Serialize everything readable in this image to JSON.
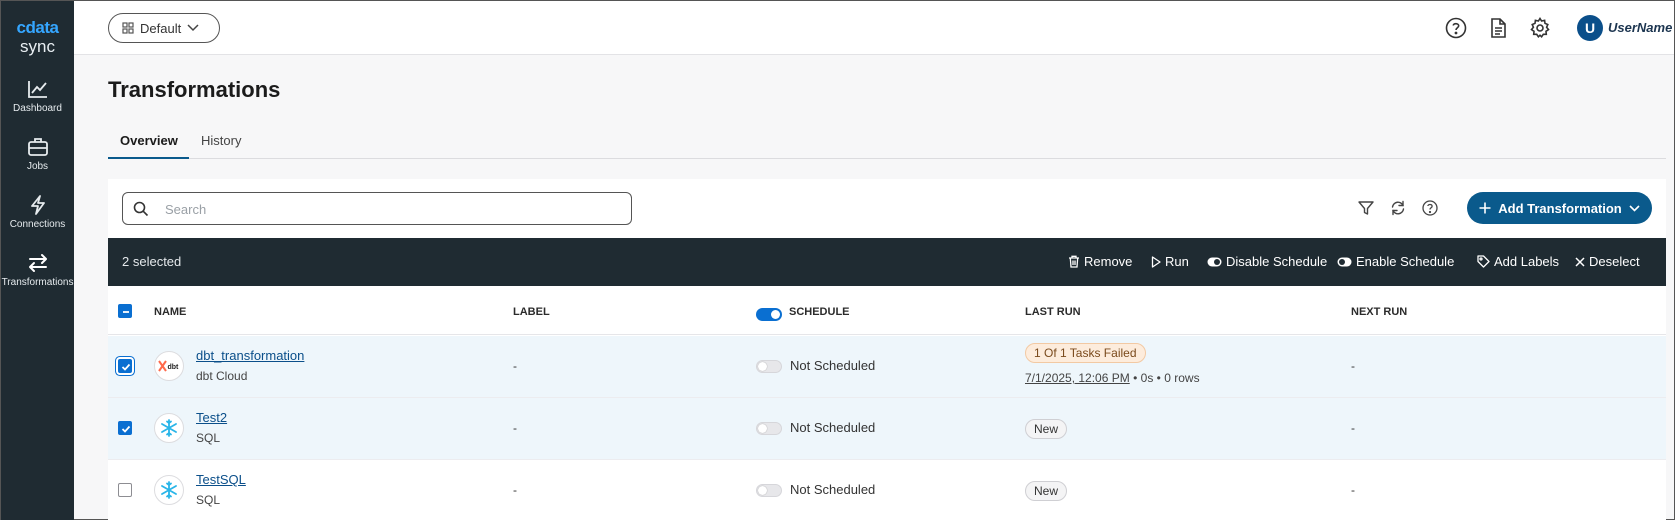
{
  "sidebar": {
    "logo_top": "cdata",
    "logo_bottom": "sync",
    "items": [
      {
        "label": "Dashboard",
        "icon": "chart-line-icon"
      },
      {
        "label": "Jobs",
        "icon": "briefcase-icon"
      },
      {
        "label": "Connections",
        "icon": "lightning-icon"
      },
      {
        "label": "Transformations",
        "icon": "arrows-exchange-icon"
      }
    ]
  },
  "topbar": {
    "workspace_label": "Default",
    "user_initial": "U",
    "username": "UserName"
  },
  "page": {
    "title": "Transformations",
    "tabs": [
      {
        "label": "Overview",
        "active": true
      },
      {
        "label": "History",
        "active": false
      }
    ]
  },
  "toolbar": {
    "search_placeholder": "Search",
    "add_label": "Add Transformation"
  },
  "selection_bar": {
    "count_label": "2 selected",
    "actions": [
      "Remove",
      "Run",
      "Disable Schedule",
      "Enable Schedule",
      "Add Labels",
      "Deselect"
    ]
  },
  "table": {
    "columns": [
      "NAME",
      "LABEL",
      "SCHEDULE",
      "LAST RUN",
      "NEXT RUN"
    ],
    "rows": [
      {
        "name": "dbt_transformation",
        "type": "dbt Cloud",
        "label": "-",
        "schedule": "Not Scheduled",
        "last_run_badge": "1 Of 1 Tasks Failed",
        "last_run_date": "7/1/2025, 12:06 PM",
        "last_run_duration": "0s",
        "last_run_rows": "0 rows",
        "next_run": "-",
        "selected": true,
        "icon_text": "dbt"
      },
      {
        "name": "Test2",
        "type": "SQL",
        "label": "-",
        "schedule": "Not Scheduled",
        "last_run_badge": "New",
        "next_run": "-",
        "selected": true
      },
      {
        "name": "TestSQL",
        "type": "SQL",
        "label": "-",
        "schedule": "Not Scheduled",
        "last_run_badge": "New",
        "next_run": "-",
        "selected": false
      }
    ]
  },
  "colors": {
    "sidebar_bg": "#1f2b32",
    "accent": "#0a5a8c",
    "checkbox": "#0a6fd1",
    "failed_badge_bg": "#fdecdc",
    "snowflake": "#29b5e8"
  }
}
